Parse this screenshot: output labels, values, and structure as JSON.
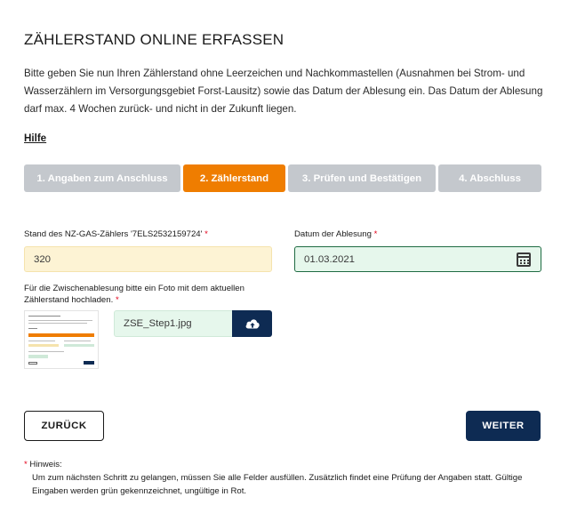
{
  "page": {
    "title": "ZÄHLERSTAND ONLINE ERFASSEN",
    "intro": "Bitte geben Sie nun Ihren Zählerstand ohne Leerzeichen und Nachkommastellen (Ausnahmen bei Strom- und Wasserzählern im Versorgungsgebiet Forst-Lausitz) sowie das Datum der Ablesung ein. Das Datum der Ablesung darf max. 4 Wochen zurück- und nicht in der Zukunft liegen.",
    "help_link": "Hilfe"
  },
  "steps": [
    {
      "label": "1. Angaben zum Anschluss",
      "state": "inactive"
    },
    {
      "label": "2. Zählerstand",
      "state": "active"
    },
    {
      "label": "3. Prüfen und Bestätigen",
      "state": "inactive"
    },
    {
      "label": "4. Abschluss",
      "state": "inactive"
    }
  ],
  "form": {
    "stand_label": "Stand des NZ-GAS-Zählers '7ELS2532159724'",
    "stand_value": "320",
    "datum_label": "Datum der Ablesung",
    "datum_value": "01.03.2021",
    "upload_label": "Für die Zwischenablesung bitte ein Foto mit dem aktuellen Zählerstand hochladen.",
    "file_name": "ZSE_Step1.jpg",
    "required_mark": "*"
  },
  "buttons": {
    "back": "ZURÜCK",
    "next": "WEITER"
  },
  "note": {
    "marker": "*",
    "heading": "Hinweis:",
    "text": "Um zum nächsten Schritt zu gelangen, müssen Sie alle Felder ausfüllen. Zusätzlich findet eine Prüfung der Angaben statt. Gültige Eingaben werden grün gekennzeichnet, ungültige in Rot."
  },
  "icons": {
    "calendar": "calendar-icon",
    "upload": "cloud-upload-icon"
  },
  "colors": {
    "active_step": "#ef7d00",
    "inactive_step": "#c4c8cd",
    "primary": "#0e2b53",
    "valid_bg": "#e6f7ec",
    "required": "#e2001a"
  }
}
